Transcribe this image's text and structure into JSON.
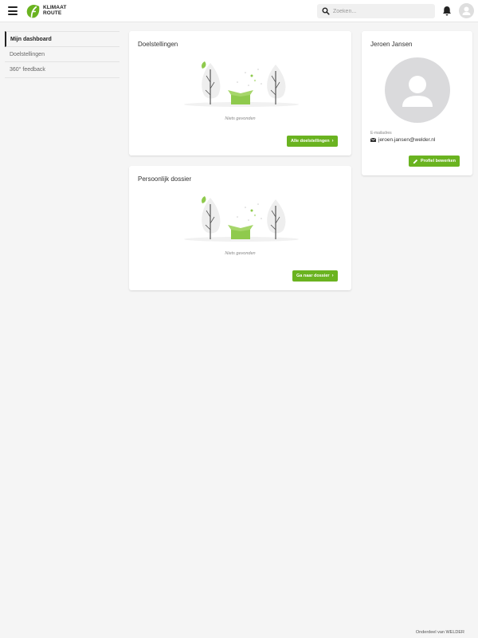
{
  "header": {
    "logo_line1": "KLIMAAT",
    "logo_line2": "ROUTE",
    "search_placeholder": "Zoeken...",
    "search_value": "",
    "brand_color": "#6ab320"
  },
  "sidebar": {
    "items": [
      {
        "label": "Mijn dashboard",
        "active": true
      },
      {
        "label": "Doelstellingen",
        "active": false
      },
      {
        "label": "360° feedback",
        "active": false
      }
    ]
  },
  "cards": {
    "goals": {
      "title": "Doelstellingen",
      "empty_text": "Niets gevonden",
      "button_label": "Alle doelstellingen"
    },
    "dossier": {
      "title": "Persoonlijk dossier",
      "empty_text": "Niets gevonden",
      "button_label": "Ga naar dossier"
    }
  },
  "profile": {
    "name": "Jeroen Jansen",
    "email_label": "E-mailadres",
    "email": "jeroen.jansen@welder.nl",
    "edit_button_label": "Profiel bewerken"
  },
  "footer": {
    "text": "Onderdeel van WELDER"
  }
}
